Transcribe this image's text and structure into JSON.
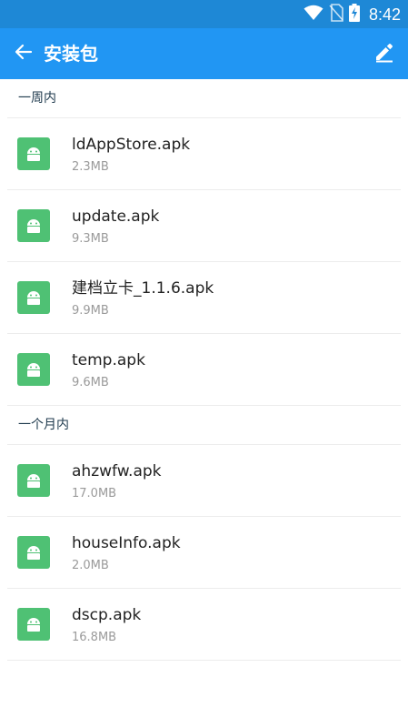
{
  "status_bar": {
    "time": "8:42",
    "icons": [
      "wifi-icon",
      "no-sim-icon",
      "battery-charging-icon"
    ]
  },
  "app_bar": {
    "title": "安装包",
    "back_icon": "arrow-left-icon",
    "edit_icon": "pencil-icon"
  },
  "sections": [
    {
      "header": "一周内",
      "files": [
        {
          "name": "ldAppStore.apk",
          "size": "2.3MB",
          "icon": "android-apk-icon"
        },
        {
          "name": "update.apk",
          "size": "9.3MB",
          "icon": "android-apk-icon"
        },
        {
          "name": "建档立卡_1.1.6.apk",
          "size": "9.9MB",
          "icon": "android-apk-icon"
        },
        {
          "name": "temp.apk",
          "size": "9.6MB",
          "icon": "android-apk-icon"
        }
      ]
    },
    {
      "header": "一个月内",
      "files": [
        {
          "name": "ahzwfw.apk",
          "size": "17.0MB",
          "icon": "android-apk-icon"
        },
        {
          "name": "houseInfo.apk",
          "size": "2.0MB",
          "icon": "android-apk-icon"
        },
        {
          "name": "dscp.apk",
          "size": "16.8MB",
          "icon": "android-apk-icon"
        }
      ]
    }
  ],
  "colors": {
    "status_bar": "#1e88d6",
    "app_bar": "#2196f3",
    "apk_icon": "#4fc174",
    "file_name": "#222222",
    "file_size": "#9a9a9a",
    "section_header": "#1f3a4d"
  }
}
